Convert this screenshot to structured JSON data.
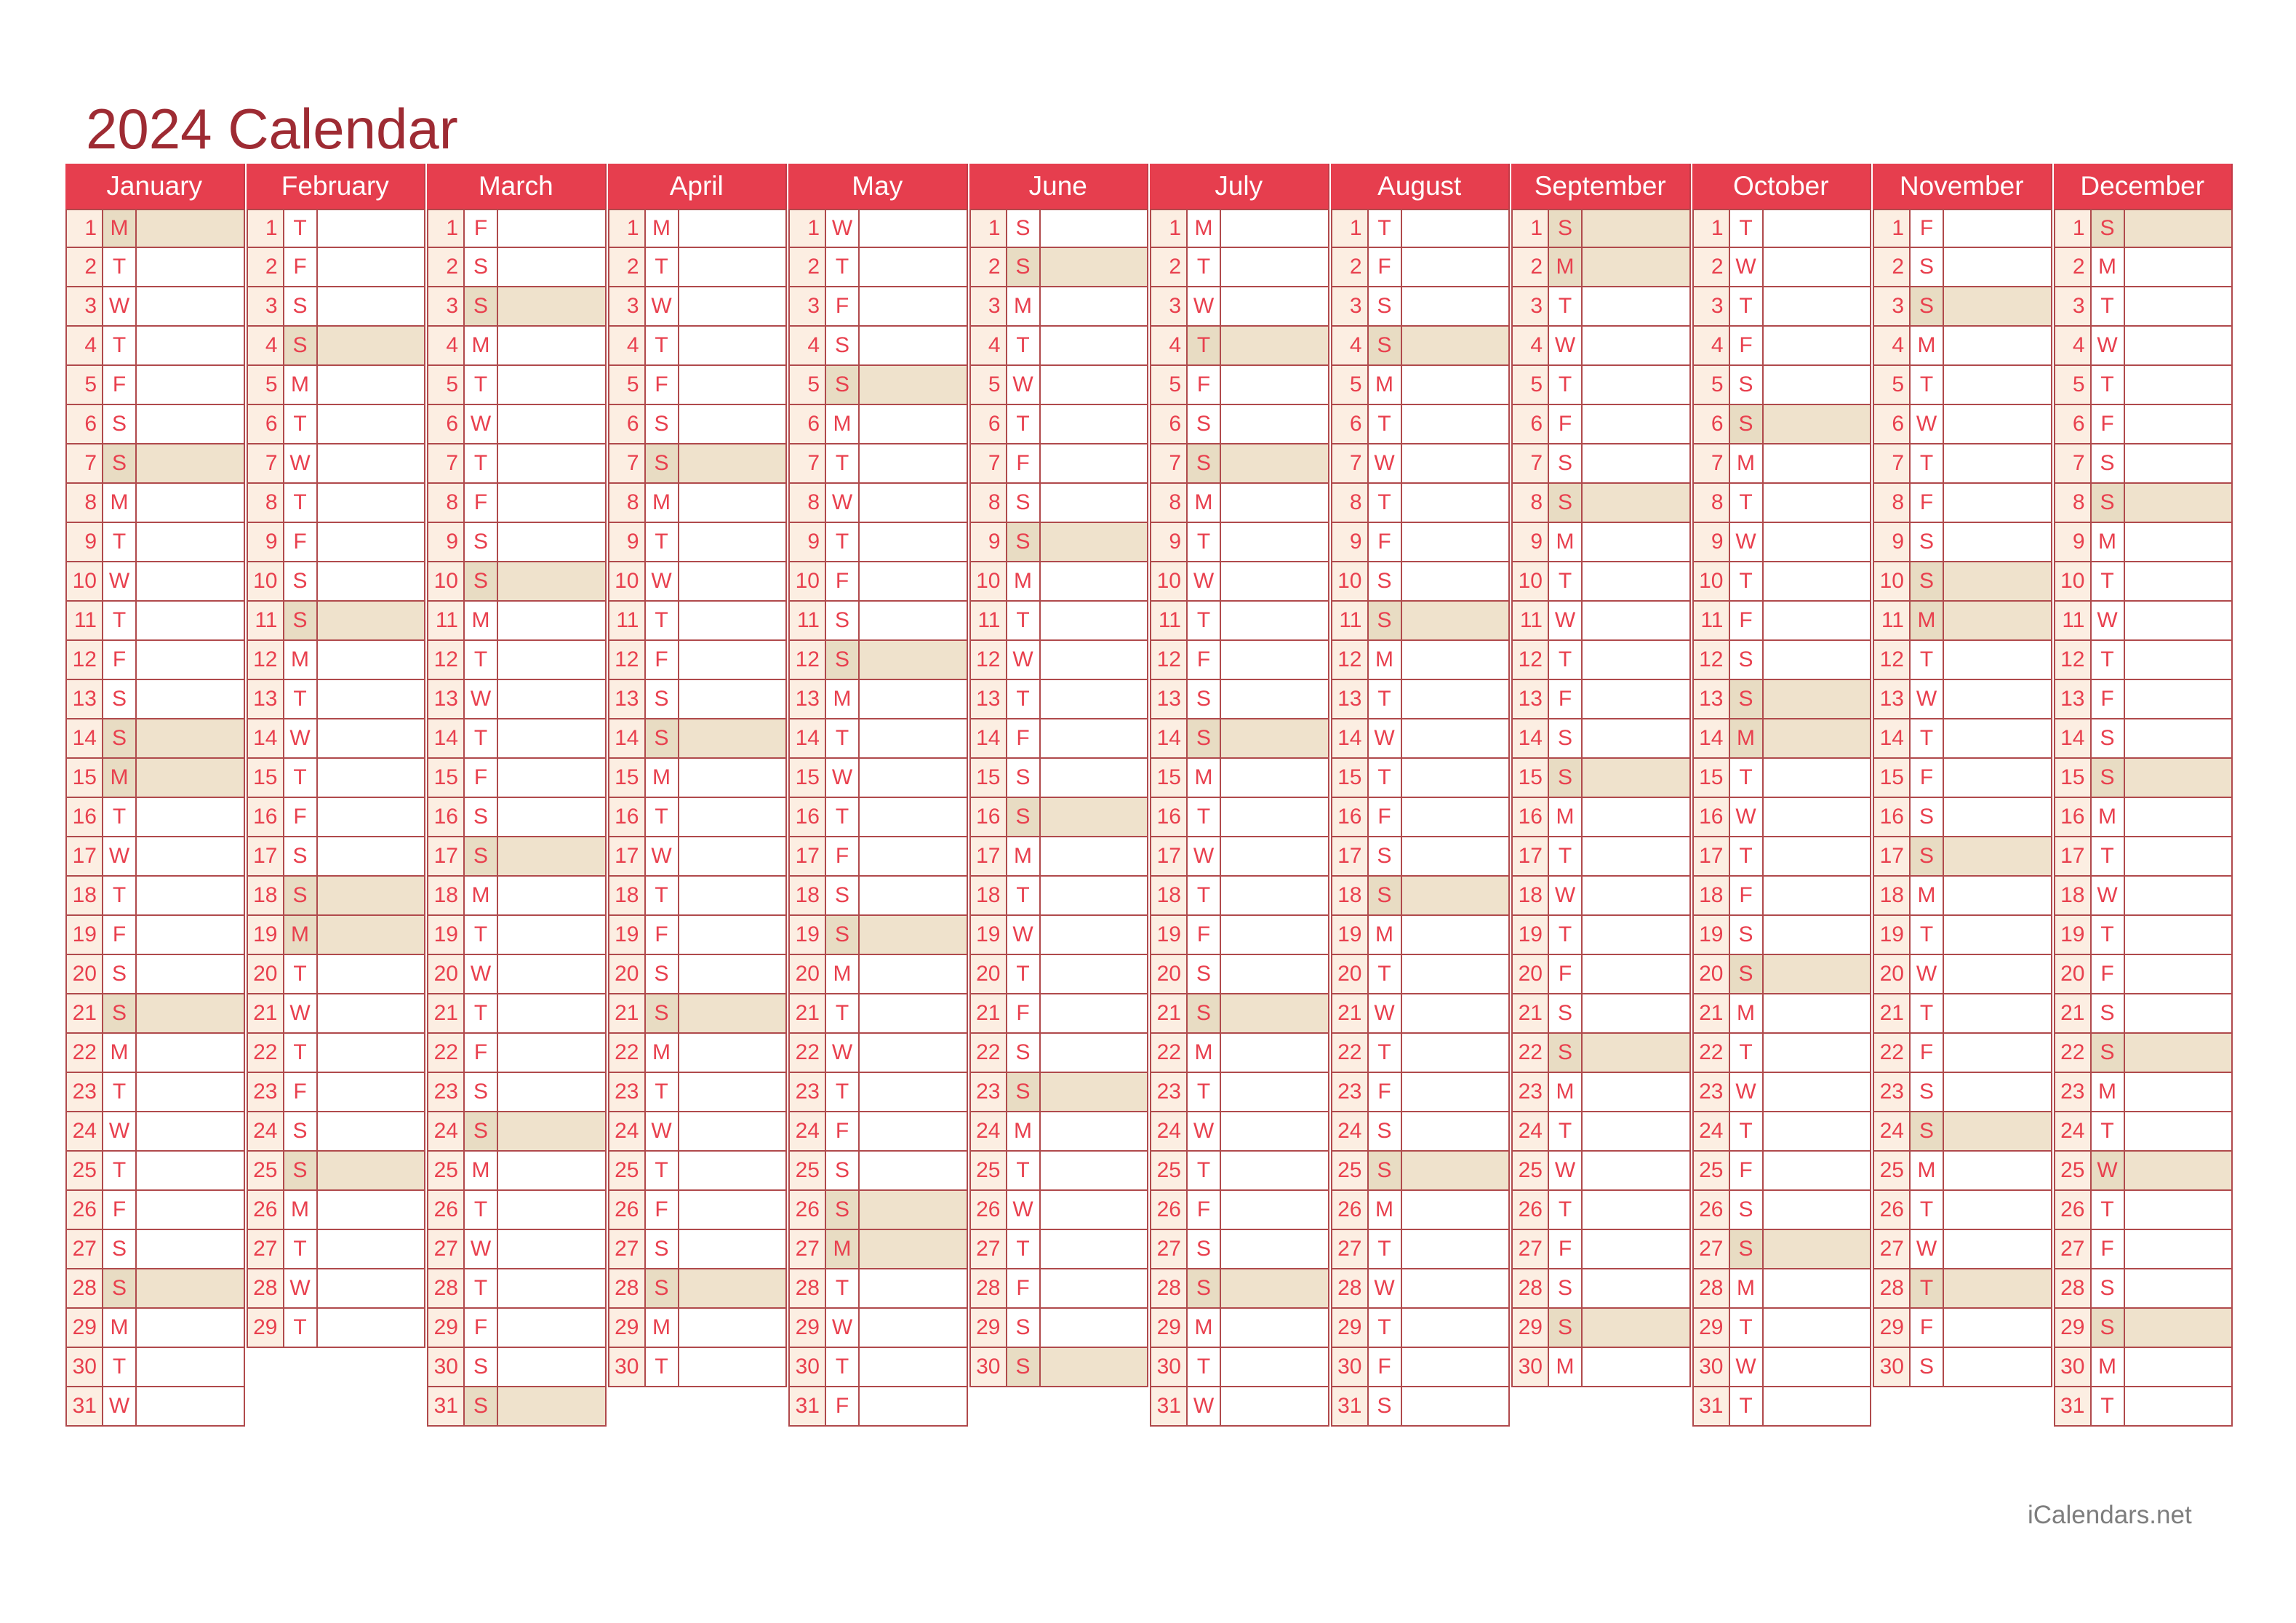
{
  "page": {
    "title": "2024 Calendar",
    "footer": "iCalendars.net",
    "year": 2024
  },
  "colors": {
    "title": "#9E2B33",
    "header_bg": "#E63E4E",
    "header_text": "#FFFFFF",
    "day_number_bg": "#FCEEE2",
    "cell_bg": "#FFFFFF",
    "highlight_dow_bg": "#E8DCC3",
    "highlight_note_bg": "#EFE2CC",
    "border": "#B04A4C",
    "day_text": "#E8404E",
    "footer_text": "#7E7E7E"
  },
  "months": [
    {
      "name": "January",
      "days": 31,
      "dow": [
        "M",
        "T",
        "W",
        "T",
        "F",
        "S",
        "S",
        "M",
        "T",
        "W",
        "T",
        "F",
        "S",
        "S",
        "M",
        "T",
        "W",
        "T",
        "F",
        "S",
        "S",
        "M",
        "T",
        "W",
        "T",
        "F",
        "S",
        "S",
        "M",
        "T",
        "W"
      ],
      "highlighted": [
        1,
        7,
        14,
        15,
        21,
        28
      ]
    },
    {
      "name": "February",
      "days": 29,
      "dow": [
        "T",
        "F",
        "S",
        "S",
        "M",
        "T",
        "W",
        "T",
        "F",
        "S",
        "S",
        "M",
        "T",
        "W",
        "T",
        "F",
        "S",
        "S",
        "M",
        "T",
        "W",
        "T",
        "F",
        "S",
        "S",
        "M",
        "T",
        "W",
        "T"
      ],
      "highlighted": [
        4,
        11,
        18,
        19,
        25
      ]
    },
    {
      "name": "March",
      "days": 31,
      "dow": [
        "F",
        "S",
        "S",
        "M",
        "T",
        "W",
        "T",
        "F",
        "S",
        "S",
        "M",
        "T",
        "W",
        "T",
        "F",
        "S",
        "S",
        "M",
        "T",
        "W",
        "T",
        "F",
        "S",
        "S",
        "M",
        "T",
        "W",
        "T",
        "F",
        "S",
        "S"
      ],
      "highlighted": [
        3,
        10,
        17,
        24,
        31
      ]
    },
    {
      "name": "April",
      "days": 30,
      "dow": [
        "M",
        "T",
        "W",
        "T",
        "F",
        "S",
        "S",
        "M",
        "T",
        "W",
        "T",
        "F",
        "S",
        "S",
        "M",
        "T",
        "W",
        "T",
        "F",
        "S",
        "S",
        "M",
        "T",
        "W",
        "T",
        "F",
        "S",
        "S",
        "M",
        "T"
      ],
      "highlighted": [
        7,
        14,
        21,
        28
      ]
    },
    {
      "name": "May",
      "days": 31,
      "dow": [
        "W",
        "T",
        "F",
        "S",
        "S",
        "M",
        "T",
        "W",
        "T",
        "F",
        "S",
        "S",
        "M",
        "T",
        "W",
        "T",
        "F",
        "S",
        "S",
        "M",
        "T",
        "W",
        "T",
        "F",
        "S",
        "S",
        "M",
        "T",
        "W",
        "T",
        "F"
      ],
      "highlighted": [
        5,
        12,
        19,
        26,
        27
      ]
    },
    {
      "name": "June",
      "days": 30,
      "dow": [
        "S",
        "S",
        "M",
        "T",
        "W",
        "T",
        "F",
        "S",
        "S",
        "M",
        "T",
        "W",
        "T",
        "F",
        "S",
        "S",
        "M",
        "T",
        "W",
        "T",
        "F",
        "S",
        "S",
        "M",
        "T",
        "W",
        "T",
        "F",
        "S",
        "S"
      ],
      "highlighted": [
        2,
        9,
        16,
        23,
        30
      ]
    },
    {
      "name": "July",
      "days": 31,
      "dow": [
        "M",
        "T",
        "W",
        "T",
        "F",
        "S",
        "S",
        "M",
        "T",
        "W",
        "T",
        "F",
        "S",
        "S",
        "M",
        "T",
        "W",
        "T",
        "F",
        "S",
        "S",
        "M",
        "T",
        "W",
        "T",
        "F",
        "S",
        "S",
        "M",
        "T",
        "W"
      ],
      "highlighted": [
        4,
        7,
        14,
        21,
        28
      ]
    },
    {
      "name": "August",
      "days": 31,
      "dow": [
        "T",
        "F",
        "S",
        "S",
        "M",
        "T",
        "W",
        "T",
        "F",
        "S",
        "S",
        "M",
        "T",
        "W",
        "T",
        "F",
        "S",
        "S",
        "M",
        "T",
        "W",
        "T",
        "F",
        "S",
        "S",
        "M",
        "T",
        "W",
        "T",
        "F",
        "S"
      ],
      "highlighted": [
        4,
        11,
        18,
        25
      ]
    },
    {
      "name": "September",
      "days": 30,
      "dow": [
        "S",
        "M",
        "T",
        "W",
        "T",
        "F",
        "S",
        "S",
        "M",
        "T",
        "W",
        "T",
        "F",
        "S",
        "S",
        "M",
        "T",
        "W",
        "T",
        "F",
        "S",
        "S",
        "M",
        "T",
        "W",
        "T",
        "F",
        "S",
        "S",
        "M"
      ],
      "highlighted": [
        1,
        2,
        8,
        15,
        22,
        29
      ]
    },
    {
      "name": "October",
      "days": 31,
      "dow": [
        "T",
        "W",
        "T",
        "F",
        "S",
        "S",
        "M",
        "T",
        "W",
        "T",
        "F",
        "S",
        "S",
        "M",
        "T",
        "W",
        "T",
        "F",
        "S",
        "S",
        "M",
        "T",
        "W",
        "T",
        "F",
        "S",
        "S",
        "M",
        "T",
        "W",
        "T"
      ],
      "highlighted": [
        6,
        13,
        14,
        20,
        27
      ]
    },
    {
      "name": "November",
      "days": 30,
      "dow": [
        "F",
        "S",
        "S",
        "M",
        "T",
        "W",
        "T",
        "F",
        "S",
        "S",
        "M",
        "T",
        "W",
        "T",
        "F",
        "S",
        "S",
        "M",
        "T",
        "W",
        "T",
        "F",
        "S",
        "S",
        "M",
        "T",
        "W",
        "T",
        "F",
        "S"
      ],
      "highlighted": [
        3,
        10,
        11,
        17,
        24,
        28
      ]
    },
    {
      "name": "December",
      "days": 31,
      "dow": [
        "S",
        "M",
        "T",
        "W",
        "T",
        "F",
        "S",
        "S",
        "M",
        "T",
        "W",
        "T",
        "F",
        "S",
        "S",
        "M",
        "T",
        "W",
        "T",
        "F",
        "S",
        "S",
        "M",
        "T",
        "W",
        "T",
        "F",
        "S",
        "S",
        "M",
        "T"
      ],
      "highlighted": [
        1,
        8,
        15,
        22,
        25,
        29
      ]
    }
  ]
}
